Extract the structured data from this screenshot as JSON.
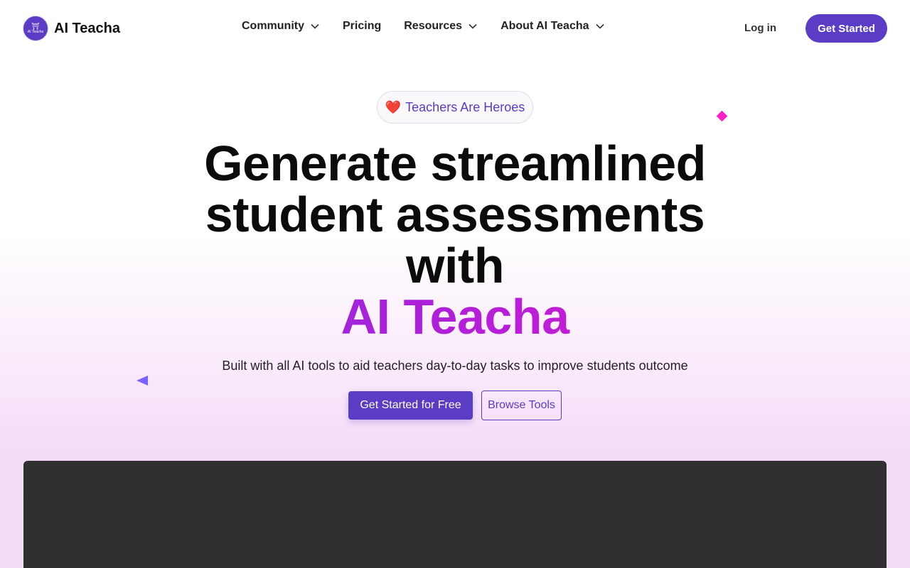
{
  "header": {
    "brand_name": "AI Teacha",
    "logo_text": "AI Teacha",
    "nav": [
      {
        "label": "Community",
        "has_dropdown": true
      },
      {
        "label": "Pricing",
        "has_dropdown": false
      },
      {
        "label": "Resources",
        "has_dropdown": true
      },
      {
        "label": "About AI Teacha",
        "has_dropdown": true
      }
    ],
    "login_label": "Log in",
    "cta_label": "Get Started"
  },
  "hero": {
    "pill_label": "Teachers Are Heroes",
    "headline_lines": [
      "Generate streamlined",
      "student assessments",
      "with"
    ],
    "headline_accent": "AI Teacha",
    "subtitle": "Built with all AI tools to aid teachers day-to-day tasks to improve students outcome",
    "primary_button": "Get Started for Free",
    "secondary_button": "Browse Tools"
  },
  "colors": {
    "brand": "#5b3cc4",
    "accent_gradient_start": "#8b2be2",
    "accent_gradient_end": "#d61ad4",
    "diamond": "#ff1fc7",
    "triangle": "#7b61ff",
    "media_panel": "#303030"
  },
  "icons": {
    "pill_icon": "heart-icon",
    "dropdown_icon": "chevron-down-icon"
  }
}
